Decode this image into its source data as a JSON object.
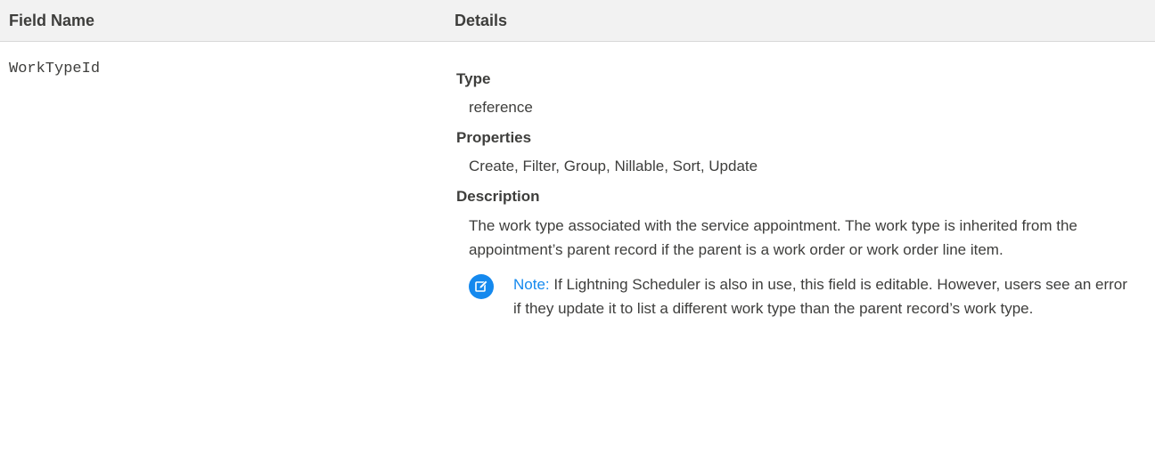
{
  "table": {
    "headers": {
      "field_name": "Field Name",
      "details": "Details"
    },
    "row": {
      "field_name": "WorkTypeId",
      "type_label": "Type",
      "type_value": "reference",
      "properties_label": "Properties",
      "properties_value": "Create, Filter, Group, Nillable, Sort, Update",
      "description_label": "Description",
      "description_value": "The work type associated with the service appointment. The work type is inherited from the appointment’s parent record if the parent is a work order or work order line item.",
      "note": {
        "icon": "edit-note-icon",
        "label": "Note:",
        "text": "If Lightning Scheduler is also in use, this field is editable. However, users see an error if they update it to list a different work type than the parent record’s work type."
      }
    }
  },
  "colors": {
    "header_bg": "#f2f2f2",
    "text": "#3e3e3c",
    "note_accent": "#1589ee"
  }
}
